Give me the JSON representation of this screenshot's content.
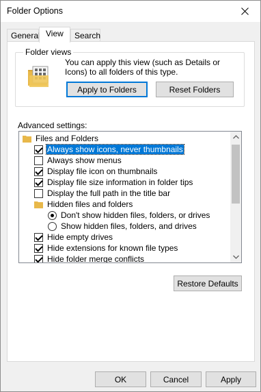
{
  "window": {
    "title": "Folder Options"
  },
  "tabs": [
    {
      "label": "General"
    },
    {
      "label": "View"
    },
    {
      "label": "Search"
    }
  ],
  "folder_views": {
    "legend": "Folder views",
    "description": "You can apply this view (such as Details or Icons) to all folders of this type.",
    "apply_button": "Apply to Folders",
    "reset_button": "Reset Folders"
  },
  "advanced": {
    "label": "Advanced settings:",
    "items": [
      {
        "kind": "folder",
        "label": "Files and Folders"
      },
      {
        "kind": "check",
        "checked": true,
        "selected": true,
        "label": "Always show icons, never thumbnails"
      },
      {
        "kind": "check",
        "checked": false,
        "label": "Always show menus"
      },
      {
        "kind": "check",
        "checked": true,
        "label": "Display file icon on thumbnails"
      },
      {
        "kind": "check",
        "checked": true,
        "label": "Display file size information in folder tips"
      },
      {
        "kind": "check",
        "checked": false,
        "label": "Display the full path in the title bar"
      },
      {
        "kind": "folder",
        "label": "Hidden files and folders"
      },
      {
        "kind": "radio",
        "checked": true,
        "label": "Don't show hidden files, folders, or drives"
      },
      {
        "kind": "radio",
        "checked": false,
        "label": "Show hidden files, folders, and drives"
      },
      {
        "kind": "check",
        "checked": true,
        "label": "Hide empty drives"
      },
      {
        "kind": "check",
        "checked": true,
        "label": "Hide extensions for known file types"
      },
      {
        "kind": "check",
        "checked": true,
        "label": "Hide folder merge conflicts"
      }
    ],
    "restore_button": "Restore Defaults"
  },
  "footer": {
    "ok": "OK",
    "cancel": "Cancel",
    "apply": "Apply"
  },
  "colors": {
    "selection": "#0078d7",
    "folder": "#e8b84a"
  }
}
